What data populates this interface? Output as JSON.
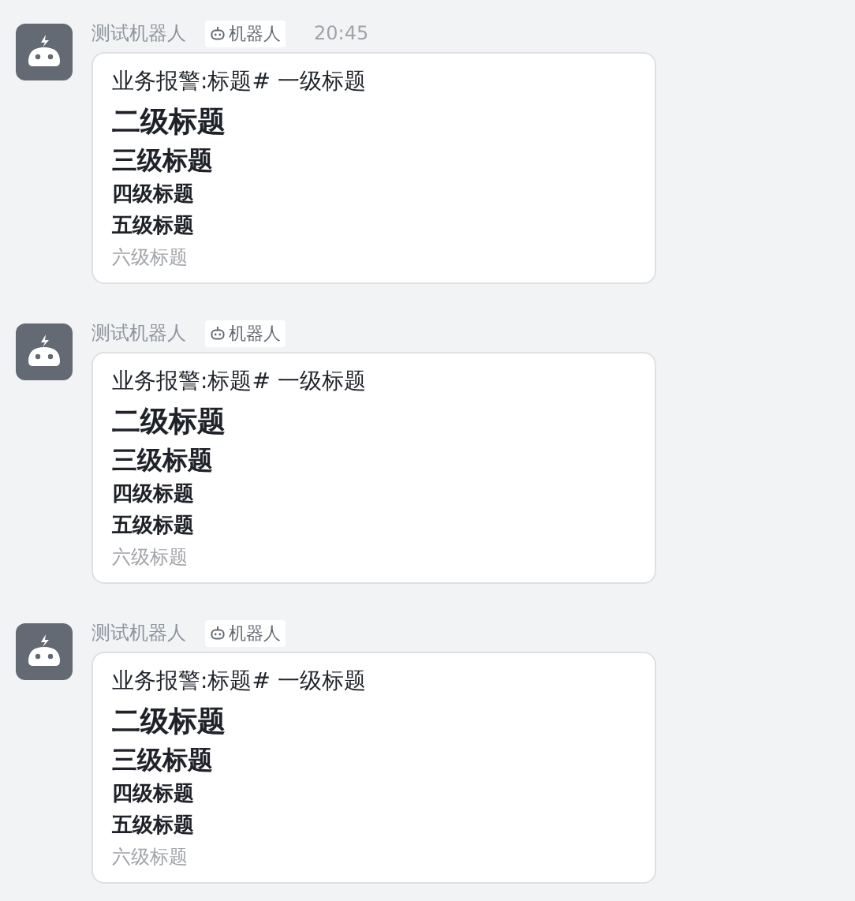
{
  "messages": [
    {
      "sender": "测试机器人",
      "badge": "机器人",
      "time": "20:45",
      "lines": [
        {
          "kind": "h1",
          "text": "业务报警:标题# 一级标题"
        },
        {
          "kind": "h2",
          "text": "二级标题"
        },
        {
          "kind": "h3",
          "text": "三级标题"
        },
        {
          "kind": "h4",
          "text": "四级标题"
        },
        {
          "kind": "h5",
          "text": "五级标题"
        },
        {
          "kind": "h6",
          "text": "六级标题"
        }
      ]
    },
    {
      "sender": "测试机器人",
      "badge": "机器人",
      "lines": [
        {
          "kind": "h1",
          "text": "业务报警:标题# 一级标题"
        },
        {
          "kind": "h2",
          "text": "二级标题"
        },
        {
          "kind": "h3",
          "text": "三级标题"
        },
        {
          "kind": "h4",
          "text": "四级标题"
        },
        {
          "kind": "h5",
          "text": "五级标题"
        },
        {
          "kind": "h6",
          "text": "六级标题"
        }
      ]
    },
    {
      "sender": "测试机器人",
      "badge": "机器人",
      "lines": [
        {
          "kind": "h1",
          "text": "业务报警:标题# 一级标题"
        },
        {
          "kind": "h2",
          "text": "二级标题"
        },
        {
          "kind": "h3",
          "text": "三级标题"
        },
        {
          "kind": "h4",
          "text": "四级标题"
        },
        {
          "kind": "h5",
          "text": "五级标题"
        },
        {
          "kind": "h6",
          "text": "六级标题"
        }
      ]
    }
  ]
}
